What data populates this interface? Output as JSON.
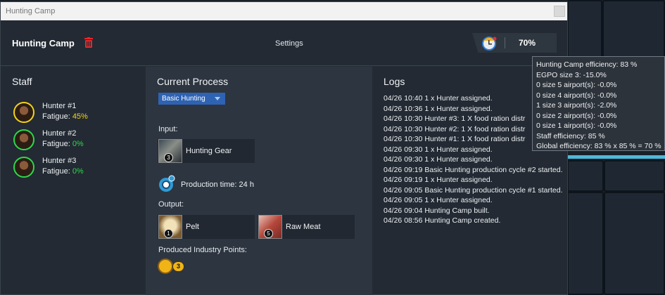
{
  "window": {
    "title": "Hunting Camp"
  },
  "header": {
    "title": "Hunting Camp",
    "settings_label": "Settings",
    "efficiency": "70%"
  },
  "staff": {
    "title": "Staff",
    "fatigue_label": "Fatigue:",
    "members": [
      {
        "name": "Hunter #1",
        "fatigue": "45%",
        "fatigue_color": "#f3d21c"
      },
      {
        "name": "Hunter #2",
        "fatigue": "0%",
        "fatigue_color": "#2bd94a"
      },
      {
        "name": "Hunter #3",
        "fatigue": "0%",
        "fatigue_color": "#2bd94a"
      }
    ]
  },
  "process": {
    "title": "Current Process",
    "selected": "Basic Hunting",
    "input_label": "Input:",
    "inputs": [
      {
        "name": "Hunting Gear",
        "qty": "3"
      }
    ],
    "production_time": "Production time: 24 h",
    "output_label": "Output:",
    "outputs": [
      {
        "name": "Pelt",
        "qty": "1"
      },
      {
        "name": "Raw Meat",
        "qty": "5"
      }
    ],
    "ip_label": "Produced Industry Points:",
    "ip_value": "3"
  },
  "logs": {
    "title": "Logs",
    "entries": [
      "04/26 10:40 1 x Hunter assigned.",
      "04/26 10:36 1 x Hunter assigned.",
      "04/26 10:30 Hunter #3: 1 X food ration distr",
      "04/26 10:30 Hunter #2: 1 X food ration distr",
      "04/26 10:30 Hunter #1: 1 X food ration distr",
      "04/26 09:30 1 x Hunter assigned.",
      "04/26 09:30 1 x Hunter assigned.",
      "04/26 09:19 Basic Hunting production cycle #2 started.",
      "04/26 09:19 1 x Hunter assigned.",
      "04/26 09:05 Basic Hunting production cycle #1 started.",
      "04/26 09:05 1 x Hunter assigned.",
      "04/26 09:04 Hunting Camp built.",
      "04/26 08:56 Hunting Camp created."
    ]
  },
  "tooltip": {
    "lines": [
      "Hunting Camp efficiency: 83 %",
      "EGPO size 3: -15.0%",
      "0 size 5 airport(s): -0.0%",
      "0 size 4 airport(s): -0.0%",
      "1 size 3 airport(s): -2.0%",
      "0 size 2 airport(s): -0.0%",
      "0 size 1 airport(s): -0.0%",
      "Staff efficiency: 85 %",
      "Global efficiency: 83 % x 85 % = 70 %"
    ]
  }
}
